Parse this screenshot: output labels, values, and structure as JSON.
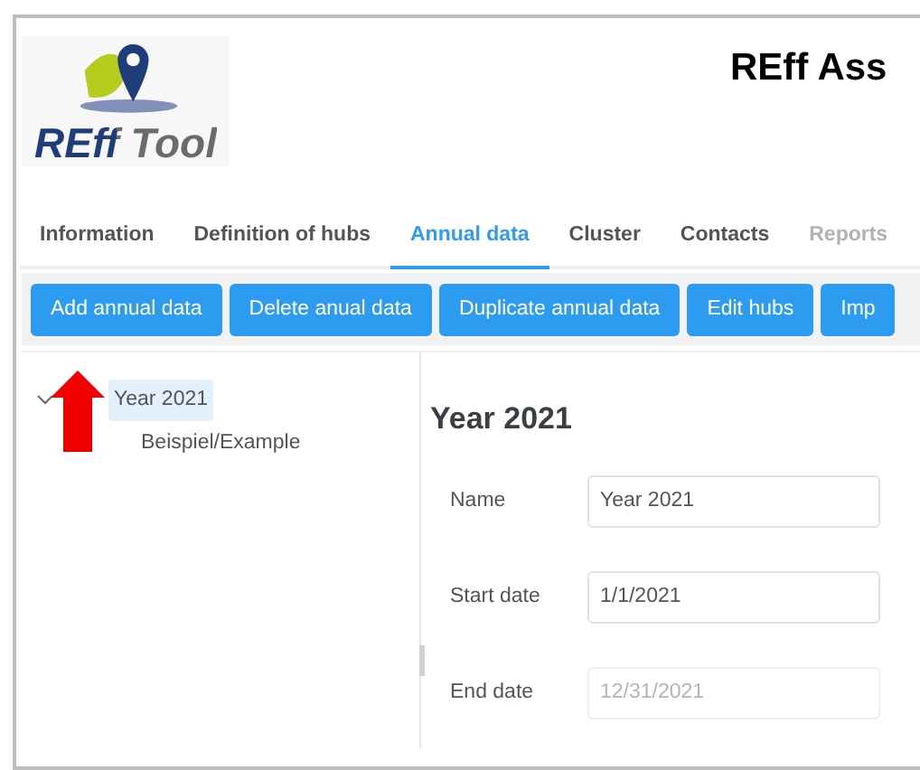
{
  "app": {
    "logo_text": "REff Tool",
    "title": "REff Ass"
  },
  "tabs": [
    {
      "label": "Information",
      "selected": false,
      "disabled": false
    },
    {
      "label": "Definition of hubs",
      "selected": false,
      "disabled": false
    },
    {
      "label": "Annual data",
      "selected": true,
      "disabled": false
    },
    {
      "label": "Cluster",
      "selected": false,
      "disabled": false
    },
    {
      "label": "Contacts",
      "selected": false,
      "disabled": false
    },
    {
      "label": "Reports",
      "selected": false,
      "disabled": true
    }
  ],
  "toolbar": [
    "Add annual data",
    "Delete anual data",
    "Duplicate annual data",
    "Edit hubs",
    "Imp"
  ],
  "tree": [
    {
      "label": "Year 2021",
      "selected": true,
      "expanded": true,
      "children": [
        {
          "label": "Beispiel/Example",
          "selected": false
        }
      ]
    }
  ],
  "detail": {
    "heading": "Year 2021",
    "fields": [
      {
        "label": "Name",
        "value": "Year 2021",
        "disabled": false
      },
      {
        "label": "Start date",
        "value": "1/1/2021",
        "disabled": false
      },
      {
        "label": "End date",
        "value": "12/31/2021",
        "disabled": true
      }
    ]
  }
}
